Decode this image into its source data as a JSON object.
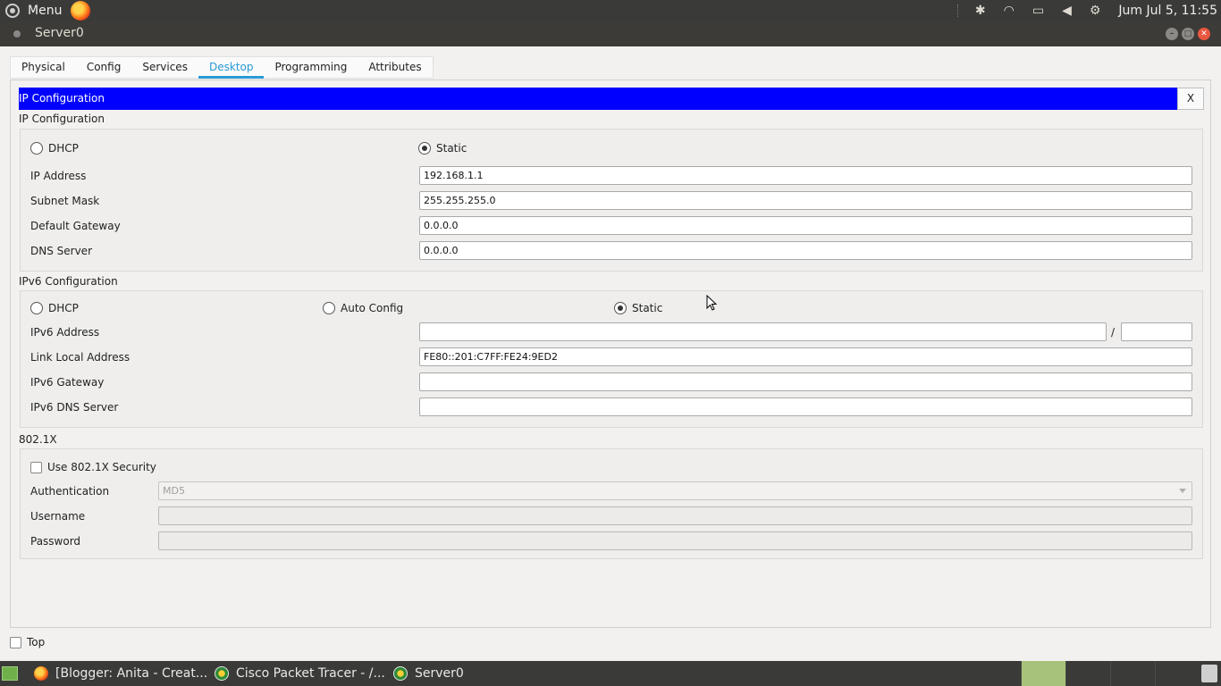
{
  "top_panel": {
    "menu_label": "Menu",
    "clock": "Jum Jul 5, 11:55"
  },
  "window": {
    "title": "Server0"
  },
  "tabs": [
    {
      "label": "Physical"
    },
    {
      "label": "Config"
    },
    {
      "label": "Services"
    },
    {
      "label": "Desktop",
      "active": true
    },
    {
      "label": "Programming"
    },
    {
      "label": "Attributes"
    }
  ],
  "ip_config": {
    "header_title": "IP Configuration",
    "close_label": "X",
    "section_label": "IP Configuration",
    "dhcp_label": "DHCP",
    "static_label": "Static",
    "mode": "Static",
    "fields": [
      {
        "label": "IP Address",
        "value": "192.168.1.1"
      },
      {
        "label": "Subnet Mask",
        "value": "255.255.255.0"
      },
      {
        "label": "Default Gateway",
        "value": "0.0.0.0"
      },
      {
        "label": "DNS Server",
        "value": "0.0.0.0"
      }
    ]
  },
  "ipv6_config": {
    "section_label": "IPv6 Configuration",
    "dhcp_label": "DHCP",
    "auto_label": "Auto Config",
    "static_label": "Static",
    "mode": "Static",
    "prefix_separator": "/",
    "address_label": "IPv6 Address",
    "address_value": "",
    "prefix_value": "",
    "link_local_label": "Link Local Address",
    "link_local_value": "FE80::201:C7FF:FE24:9ED2",
    "gateway_label": "IPv6 Gateway",
    "gateway_value": "",
    "dns_label": "IPv6 DNS Server",
    "dns_value": ""
  },
  "dot1x": {
    "section_label": "802.1X",
    "use_security_label": "Use 802.1X Security",
    "use_security_checked": false,
    "auth_label": "Authentication",
    "auth_value": "MD5",
    "username_label": "Username",
    "username_value": "",
    "password_label": "Password",
    "password_value": ""
  },
  "top_option": {
    "label": "Top",
    "checked": false
  },
  "taskbar": {
    "tasks": [
      {
        "label": "[Blogger: Anita - Creat...",
        "icon": "firefox-icon"
      },
      {
        "label": "Cisco Packet Tracer - /...",
        "icon": "packet-tracer-icon"
      },
      {
        "label": "Server0",
        "icon": "packet-tracer-icon"
      }
    ]
  },
  "colors": {
    "header_blue": "#0000ff",
    "tab_accent": "#2a9ad6"
  }
}
